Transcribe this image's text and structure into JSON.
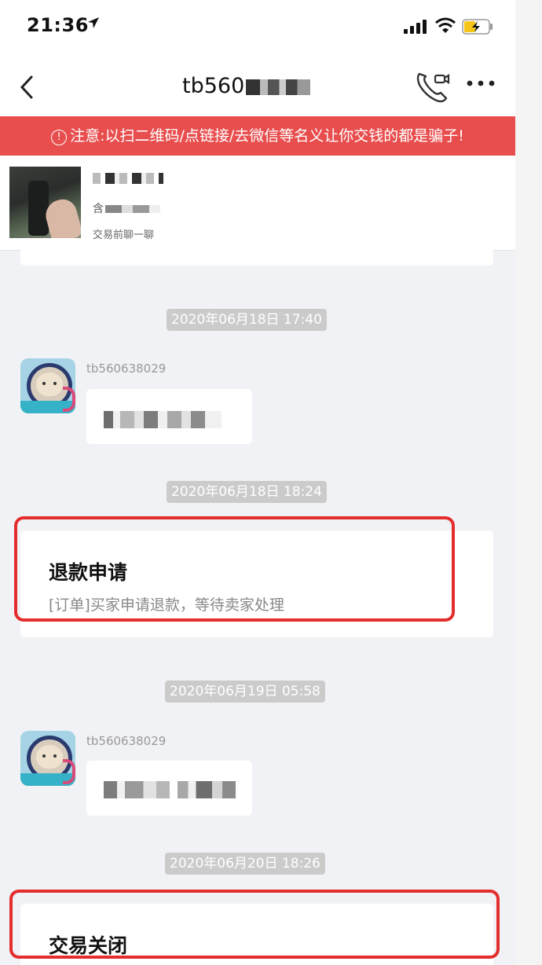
{
  "status_bar": {
    "time": "21:36"
  },
  "nav": {
    "title_prefix": "tb560"
  },
  "warning": {
    "icon": "!",
    "text": "注意:以扫二维码/点链接/去微信等名义让你交钱的都是骗子!"
  },
  "product": {
    "price_prefix": "含",
    "hint": "交易前聊一聊"
  },
  "messages": {
    "ts1": "2020年06月18日 17:40",
    "user1": "tb560638029",
    "ts2": "2020年06月18日 18:24",
    "refund_title": "退款申请",
    "refund_desc": "[订单]买家申请退款，等待卖家处理",
    "ts3": "2020年06月19日 05:58",
    "user2": "tb560638029",
    "ts4": "2020年06月20日 18:26",
    "closed_title": "交易关闭"
  },
  "colors": {
    "warning_bg": "#e84e4e",
    "highlight_border": "#e42d2d",
    "timestamp_bg": "#cbcbcb"
  }
}
